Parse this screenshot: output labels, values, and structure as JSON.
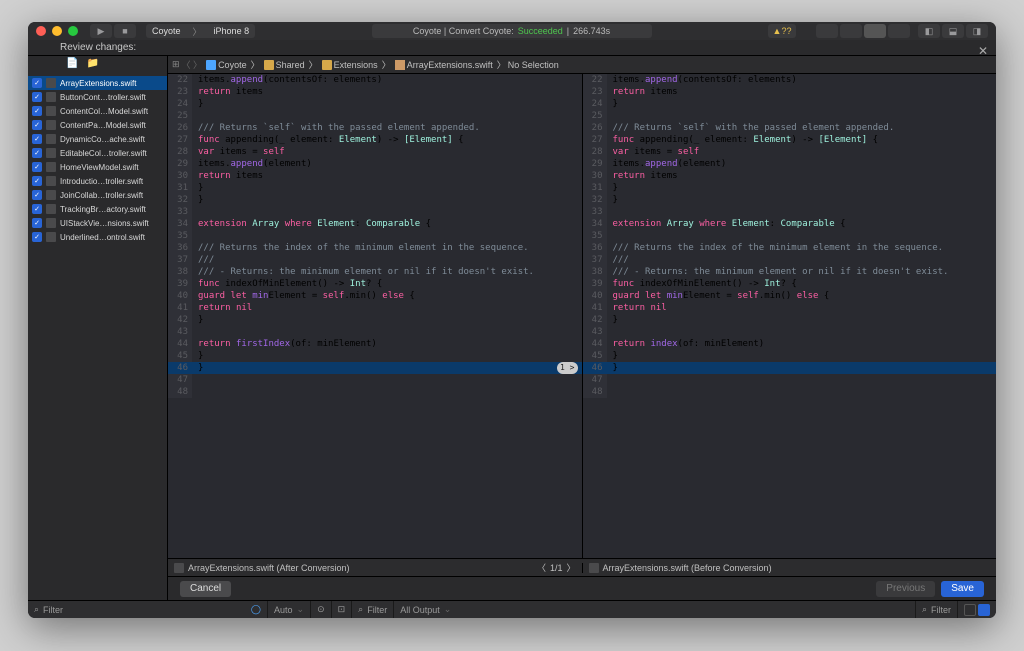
{
  "titlebar": {
    "scheme_app": "Coyote",
    "scheme_device": "iPhone 8",
    "status_prefix": "Coyote | Convert Coyote:",
    "status_result": "Succeeded",
    "status_time": "266.743s",
    "warn_count": "??"
  },
  "review_label": "Review changes:",
  "files": [
    "ArrayExtensions.swift",
    "ButtonCont…troller.swift",
    "ContentCol…Model.swift",
    "ContentPa…Model.swift",
    "DynamicCo…ache.swift",
    "EditableCol…troller.swift",
    "HomeViewModel.swift",
    "Introductio…troller.swift",
    "JoinCollab…troller.swift",
    "TrackingBr…actory.swift",
    "UIStackVie…nsions.swift",
    "Underlined…ontrol.swift"
  ],
  "selected_file_index": 0,
  "jumpbar": {
    "root": "Coyote",
    "group": "Shared",
    "subgroup": "Extensions",
    "file": "ArrayExtensions.swift",
    "selection": "No Selection"
  },
  "lines_start": 22,
  "left": {
    "title": "ArrayExtensions.swift (After Conversion)",
    "highlight_line": 46,
    "highlight_badge": "1 >",
    "rows": [
      {
        "t": "        items.append(contentsOf: elements)",
        "p": [
          [
            "append",
            "fn"
          ]
        ]
      },
      {
        "t": "        return items",
        "p": [
          [
            "return",
            "kw"
          ]
        ]
      },
      {
        "t": "    }"
      },
      {
        "t": ""
      },
      {
        "t": "    /// Returns `self` with the passed element appended.",
        "p": [
          [
            "/// Returns `self` with the passed element appended.",
            "cm"
          ]
        ]
      },
      {
        "t": "    func appending(_ element: Element) -> [Element] {",
        "p": [
          [
            "func",
            "kw"
          ],
          [
            "Element",
            "ty"
          ],
          [
            "[Element]",
            "ty"
          ]
        ]
      },
      {
        "t": "        var items = self",
        "p": [
          [
            "var",
            "kw"
          ],
          [
            "self",
            "kw"
          ]
        ]
      },
      {
        "t": "        items.append(element)",
        "p": [
          [
            "append",
            "fn"
          ]
        ]
      },
      {
        "t": "        return items",
        "p": [
          [
            "return",
            "kw"
          ]
        ]
      },
      {
        "t": "    }"
      },
      {
        "t": "}"
      },
      {
        "t": ""
      },
      {
        "t": "extension Array where Element: Comparable {",
        "p": [
          [
            "extension",
            "kw"
          ],
          [
            "Array",
            "ty"
          ],
          [
            "where",
            "kw"
          ],
          [
            "Element",
            "ty"
          ],
          [
            "Comparable",
            "ty"
          ]
        ]
      },
      {
        "t": ""
      },
      {
        "t": "    /// Returns the index of the minimum element in the sequence.",
        "p": [
          [
            "/// Returns the index of the minimum element in the sequence.",
            "cm"
          ]
        ]
      },
      {
        "t": "    ///",
        "p": [
          [
            "///",
            "cm"
          ]
        ]
      },
      {
        "t": "    /// - Returns: the minimum element or nil if it doesn't exist.",
        "p": [
          [
            "/// - Returns: the minimum element or nil if it doesn't exist.",
            "cm"
          ]
        ]
      },
      {
        "t": "    func indexOfMinElement() -> Int? {",
        "p": [
          [
            "func",
            "kw"
          ],
          [
            "Int",
            "ty"
          ]
        ]
      },
      {
        "t": "        guard let minElement = self.min() else {",
        "p": [
          [
            "guard",
            "kw"
          ],
          [
            "let",
            "kw"
          ],
          [
            "self",
            "kw"
          ],
          [
            "min",
            "fn"
          ],
          [
            "else",
            "kw"
          ]
        ]
      },
      {
        "t": "            return nil",
        "p": [
          [
            "return",
            "kw"
          ],
          [
            "nil",
            "kw"
          ]
        ]
      },
      {
        "t": "        }"
      },
      {
        "t": ""
      },
      {
        "t": "        return firstIndex(of: minElement)",
        "p": [
          [
            "return",
            "kw"
          ],
          [
            "firstIndex",
            "fn"
          ]
        ]
      },
      {
        "t": "    }"
      },
      {
        "t": "}"
      },
      {
        "t": ""
      },
      {
        "t": ""
      }
    ]
  },
  "right": {
    "title": "ArrayExtensions.swift (Before Conversion)",
    "highlight_line": 46,
    "rows": [
      {
        "t": "        items.append(contentsOf: elements)",
        "p": [
          [
            "append",
            "fn"
          ]
        ]
      },
      {
        "t": "        return items",
        "p": [
          [
            "return",
            "kw"
          ]
        ]
      },
      {
        "t": "    }"
      },
      {
        "t": ""
      },
      {
        "t": "    /// Returns `self` with the passed element appended.",
        "p": [
          [
            "/// Returns `self` with the passed element appended.",
            "cm"
          ]
        ]
      },
      {
        "t": "    func appending(_ element: Element) -> [Element] {",
        "p": [
          [
            "func",
            "kw"
          ],
          [
            "Element",
            "ty"
          ],
          [
            "[Element]",
            "ty"
          ]
        ]
      },
      {
        "t": "        var items = self",
        "p": [
          [
            "var",
            "kw"
          ],
          [
            "self",
            "kw"
          ]
        ]
      },
      {
        "t": "        items.append(element)",
        "p": [
          [
            "append",
            "fn"
          ]
        ]
      },
      {
        "t": "        return items",
        "p": [
          [
            "return",
            "kw"
          ]
        ]
      },
      {
        "t": "    }"
      },
      {
        "t": "}"
      },
      {
        "t": ""
      },
      {
        "t": "extension Array where Element: Comparable {",
        "p": [
          [
            "extension",
            "kw"
          ],
          [
            "Array",
            "ty"
          ],
          [
            "where",
            "kw"
          ],
          [
            "Element",
            "ty"
          ],
          [
            "Comparable",
            "ty"
          ]
        ]
      },
      {
        "t": ""
      },
      {
        "t": "    /// Returns the index of the minimum element in the sequence.",
        "p": [
          [
            "/// Returns the index of the minimum element in the sequence.",
            "cm"
          ]
        ]
      },
      {
        "t": "    ///",
        "p": [
          [
            "///",
            "cm"
          ]
        ]
      },
      {
        "t": "    /// - Returns: the minimum element or nil if it doesn't exist.",
        "p": [
          [
            "/// - Returns: the minimum element or nil if it doesn't exist.",
            "cm"
          ]
        ]
      },
      {
        "t": "    func indexOfMinElement() -> Int? {",
        "p": [
          [
            "func",
            "kw"
          ],
          [
            "Int",
            "ty"
          ]
        ]
      },
      {
        "t": "        guard let minElement = self.min() else {",
        "p": [
          [
            "guard",
            "kw"
          ],
          [
            "let",
            "kw"
          ],
          [
            "self",
            "kw"
          ],
          [
            "min",
            "fn"
          ],
          [
            "else",
            "kw"
          ]
        ]
      },
      {
        "t": "            return nil",
        "p": [
          [
            "return",
            "kw"
          ],
          [
            "nil",
            "kw"
          ]
        ]
      },
      {
        "t": "        }"
      },
      {
        "t": ""
      },
      {
        "t": "        return index(of: minElement)",
        "p": [
          [
            "return",
            "kw"
          ],
          [
            "index",
            "fn"
          ]
        ]
      },
      {
        "t": "    }"
      },
      {
        "t": "}"
      },
      {
        "t": ""
      },
      {
        "t": ""
      }
    ]
  },
  "nav_pos": "1/1",
  "buttons": {
    "cancel": "Cancel",
    "previous": "Previous",
    "save": "Save"
  },
  "bottom": {
    "filter": "Filter",
    "auto": "Auto",
    "all_output": "All Output"
  }
}
